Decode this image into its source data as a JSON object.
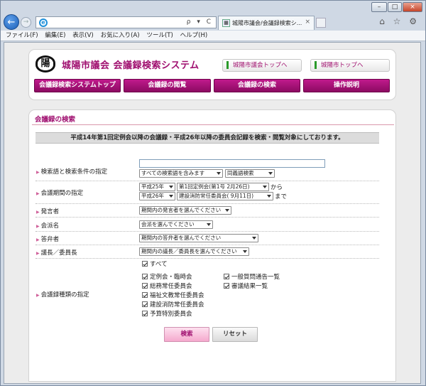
{
  "browser": {
    "tab_title": "城陽市議会/会議録検索シ...",
    "menu": [
      "ファイル(F)",
      "編集(E)",
      "表示(V)",
      "お気に入り(A)",
      "ツール(T)",
      "ヘルプ(H)"
    ],
    "address_tools": "ρ ▾ C",
    "window_controls": {
      "minimize": "–",
      "maximize": "□",
      "close": "×"
    },
    "tab_close": "×",
    "right_icons": "⌂ ☆ ⚙"
  },
  "header": {
    "logo_text": "陽",
    "title": "城陽市議会 会議録検索システム",
    "links": [
      "城陽市議会トップへ",
      "城陽市トップへ"
    ],
    "nav": [
      "会議録検索システムトップ",
      "会議録の閲覧",
      "会議録の検索",
      "操作説明"
    ]
  },
  "panel": {
    "title": "会議録の検索",
    "notice": "平成14年第1回定例会以降の会議録・平成26年以降の委員会記録を検索・閲覧対象にしております。",
    "keyword": {
      "label": "検索語と検索条件の指定",
      "input_value": "",
      "condition": "すべての検索語を含みます",
      "synonym": "同義語検索"
    },
    "period": {
      "label": "会議期間の指定",
      "from_year": "平成25年",
      "from_meeting": "第1回定例会(第1号 2月26日)",
      "from_suffix": "から",
      "to_year": "平成26年",
      "to_meeting": "建設消防常任委員会( 9月11日)",
      "to_suffix": "まで"
    },
    "speaker": {
      "label": "発言者",
      "value": "期間内の発言者を選んでください"
    },
    "party": {
      "label": "会派名",
      "value": "会派を選んでください"
    },
    "answerer": {
      "label": "答弁者",
      "value": "期間内の答弁者を選んでください"
    },
    "chair": {
      "label": "議長／委員長",
      "value": "期間内の議長／委員長を選んでください"
    },
    "types": {
      "label": "会議録種類の指定",
      "all": "すべて",
      "items": [
        "定例会・臨時会",
        "一般質問通告一覧",
        "総務常任委員会",
        "審議結果一覧",
        "福祉文教常任委員会",
        "建設消防常任委員会",
        "予算特別委員会"
      ]
    },
    "buttons": {
      "search": "検索",
      "reset": "リセット"
    }
  }
}
